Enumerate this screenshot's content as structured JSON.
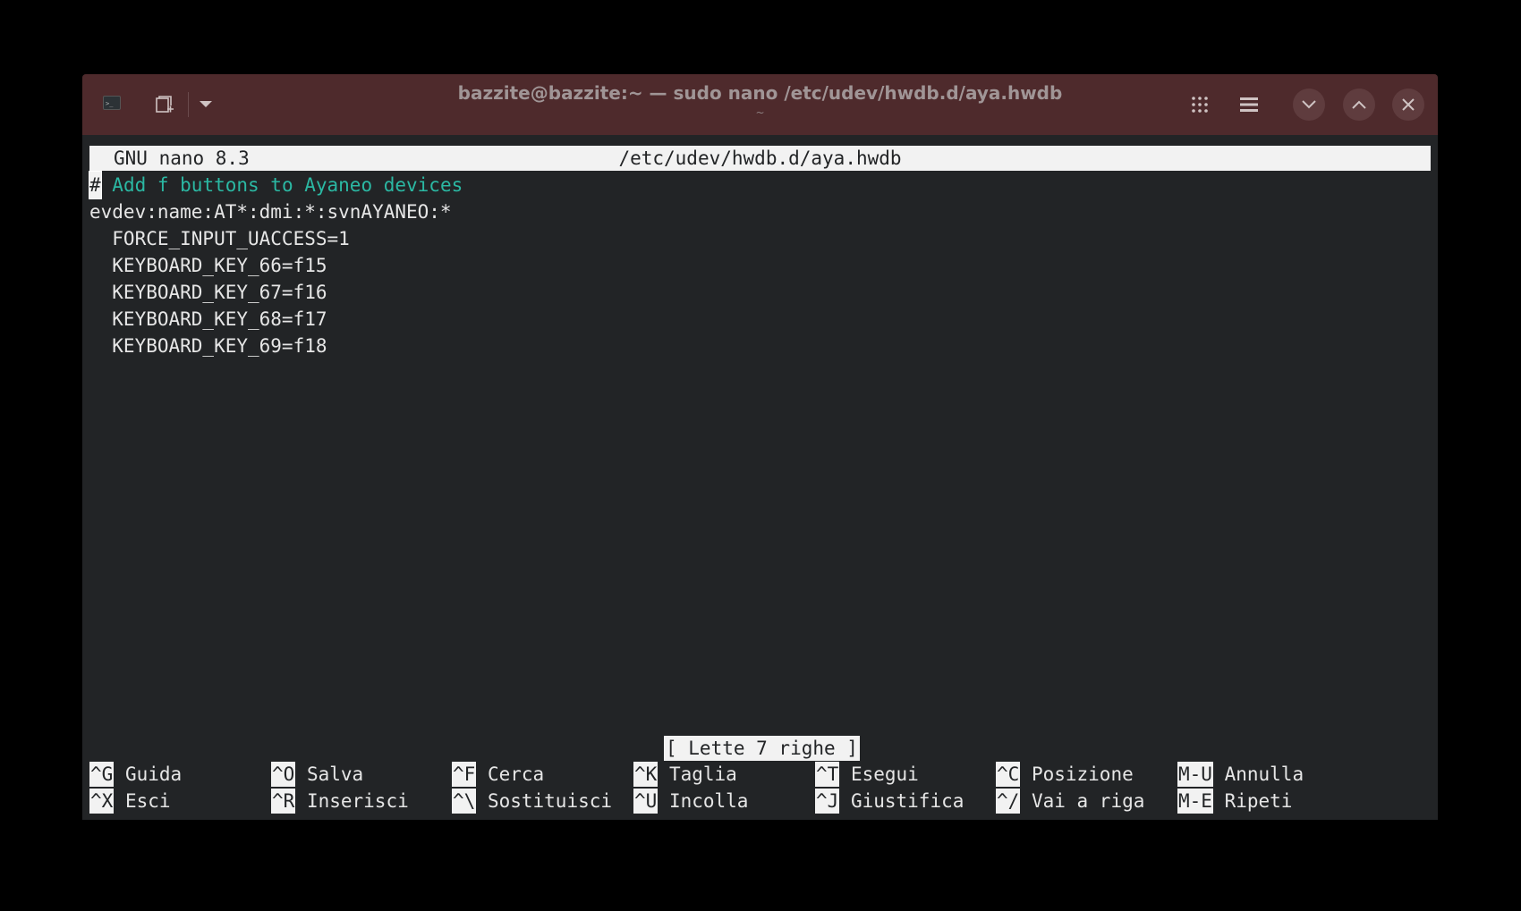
{
  "titlebar": {
    "title": "bazzite@bazzite:~ — sudo nano /etc/udev/hwdb.d/aya.hwdb",
    "subtitle": "~"
  },
  "nano": {
    "version": "GNU nano 8.3",
    "filename": "/etc/udev/hwdb.d/aya.hwdb",
    "cursor_char": "#",
    "lines": [
      " Add f buttons to Ayaneo devices",
      "evdev:name:AT*:dmi:*:svnAYANEO:*",
      "  FORCE_INPUT_UACCESS=1",
      "  KEYBOARD_KEY_66=f15",
      "  KEYBOARD_KEY_67=f16",
      "  KEYBOARD_KEY_68=f17",
      "  KEYBOARD_KEY_69=f18"
    ],
    "status": "[ Lette 7 righe ]",
    "shortcuts": [
      {
        "key": "^G",
        "label": "Guida"
      },
      {
        "key": "^X",
        "label": "Esci"
      },
      {
        "key": "^O",
        "label": "Salva"
      },
      {
        "key": "^R",
        "label": "Inserisci"
      },
      {
        "key": "^F",
        "label": "Cerca"
      },
      {
        "key": "^\\",
        "label": "Sostituisci"
      },
      {
        "key": "^K",
        "label": "Taglia"
      },
      {
        "key": "^U",
        "label": "Incolla"
      },
      {
        "key": "^T",
        "label": "Esegui"
      },
      {
        "key": "^J",
        "label": "Giustifica"
      },
      {
        "key": "^C",
        "label": "Posizione"
      },
      {
        "key": "^/",
        "label": "Vai a riga"
      },
      {
        "key": "M-U",
        "label": "Annulla"
      },
      {
        "key": "M-E",
        "label": "Ripeti"
      }
    ]
  }
}
